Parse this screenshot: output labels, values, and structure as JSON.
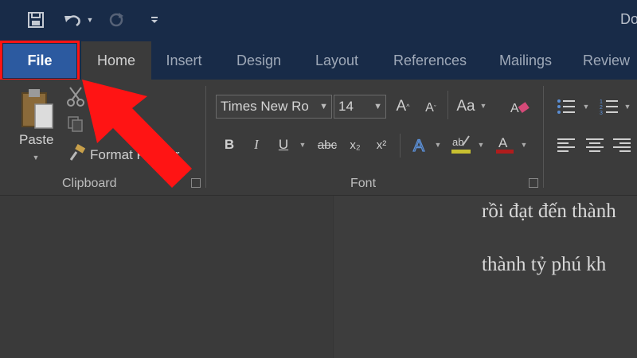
{
  "quick_access": {
    "icons": [
      "save-icon",
      "undo-icon",
      "undo-dropdown-icon",
      "redo-icon",
      "customize-icon"
    ]
  },
  "title": {
    "text": "Do"
  },
  "tabs": [
    {
      "label": "File"
    },
    {
      "label": "Home"
    },
    {
      "label": "Insert"
    },
    {
      "label": "Design"
    },
    {
      "label": "Layout"
    },
    {
      "label": "References"
    },
    {
      "label": "Mailings"
    },
    {
      "label": "Review"
    }
  ],
  "ribbon": {
    "clipboard": {
      "label": "Clipboard",
      "paste_label": "Paste",
      "format_painter_label": "Format Painter"
    },
    "font": {
      "label": "Font",
      "font_name": "Times New Ro",
      "font_size": "14",
      "bold": "B",
      "italic": "I",
      "underline": "U",
      "strikethrough": "abc",
      "subscript": "x₂",
      "superscript": "x²",
      "change_case": "Aa"
    }
  },
  "document": {
    "lines": [
      "rồi đạt đến thành",
      "thành tỷ phú kh"
    ]
  },
  "colors": {
    "titlebar": "#182b48",
    "file_tab": "#2c5aa0",
    "highlight": "#ff1414",
    "arrow": "#ff1414"
  }
}
